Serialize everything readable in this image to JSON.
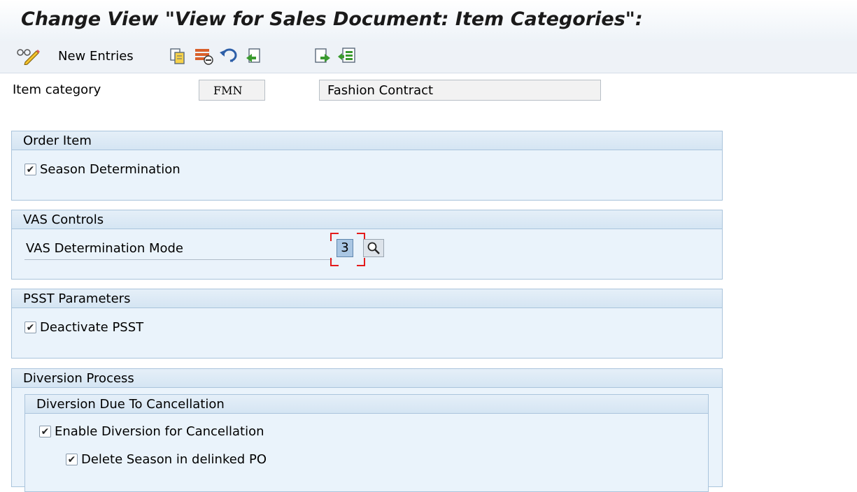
{
  "window": {
    "title": "Change View \"View for Sales Document: Item Categories\": "
  },
  "toolbar": {
    "new_entries_label": "New Entries",
    "icons": [
      "display-change-icon",
      "copy-icon",
      "delete-icon",
      "undo-icon",
      "previous-entry-icon",
      "next-entry-icon",
      "select-all-icon"
    ]
  },
  "header": {
    "item_category_label": "Item category",
    "item_category_value": "FMN",
    "item_category_description": "Fashion Contract"
  },
  "groups": {
    "order_item": {
      "title": "Order Item",
      "season_determination_label": "Season Determination",
      "season_determination_checked": true
    },
    "vas_controls": {
      "title": "VAS Controls",
      "vas_mode_label": "VAS Determination Mode",
      "vas_mode_value": "3"
    },
    "psst_parameters": {
      "title": "PSST Parameters",
      "deactivate_psst_label": "Deactivate PSST",
      "deactivate_psst_checked": true
    },
    "diversion_process": {
      "title": "Diversion Process",
      "subgroup_title": "Diversion Due To Cancellation",
      "enable_diversion_label": "Enable Diversion for Cancellation",
      "enable_diversion_checked": true,
      "delete_season_label": "Delete Season in delinked PO",
      "delete_season_checked": true
    }
  },
  "colors": {
    "group_background": "#eaf3fb",
    "group_border": "#aac4dc",
    "focus": "#e31b1b",
    "input_highlight": "#a9c6e3"
  }
}
